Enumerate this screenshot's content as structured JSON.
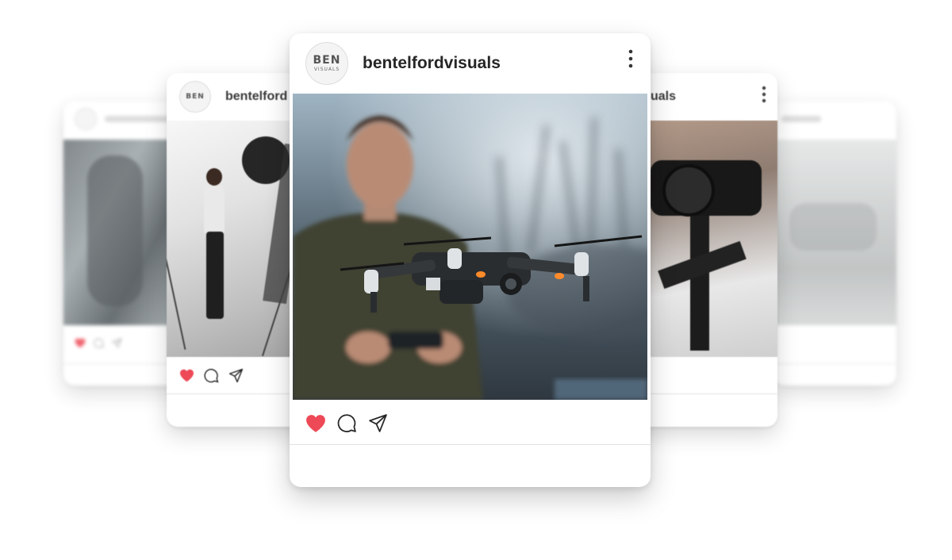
{
  "main_post": {
    "username": "bentelfordvisuals",
    "avatar_logo": "BEN",
    "avatar_sub": "VISUALS",
    "menu_icon": "more-vertical-icon",
    "actions": [
      "heart-icon",
      "comment-icon",
      "send-icon"
    ],
    "liked": true
  },
  "mid_left_post": {
    "username": "bentelford"
  },
  "mid_right_post": {
    "username": "uals"
  },
  "colors": {
    "like": "#ed4956",
    "text": "#262626",
    "divider": "#e2e2e2"
  }
}
